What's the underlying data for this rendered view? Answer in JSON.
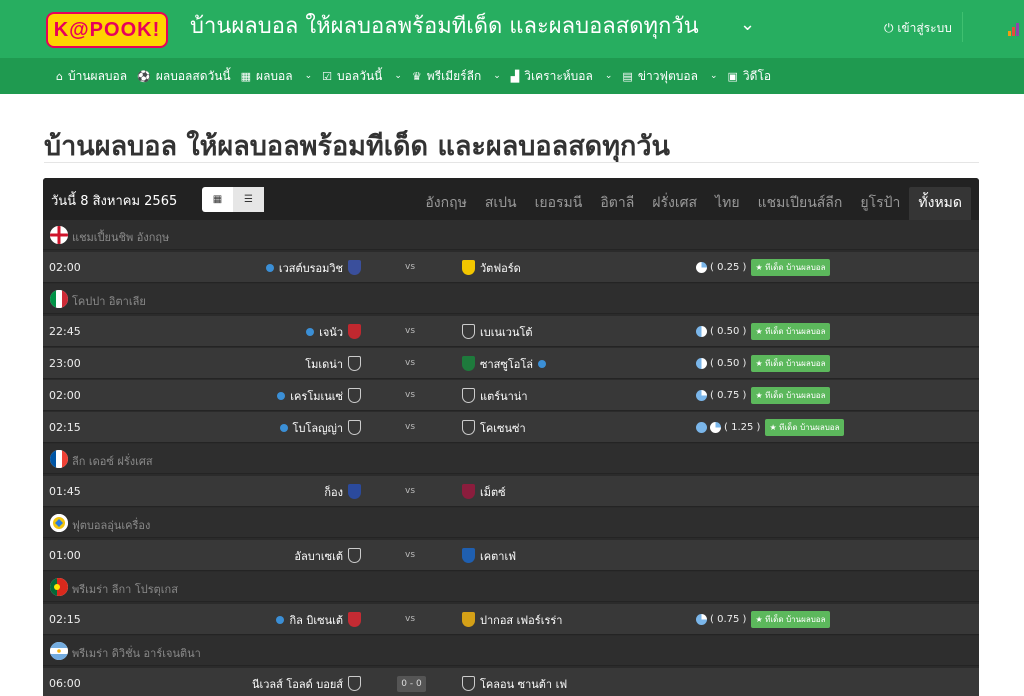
{
  "header": {
    "logo": "K@POOK!",
    "title": "บ้านผลบอล ให้ผลบอลพร้อมทีเด็ด และผลบอลสดทุกวัน",
    "login": "เข้าสู่ระบบ"
  },
  "nav": [
    {
      "label": "บ้านผลบอล",
      "icon": "home-icon",
      "glyph": "⌂",
      "dd": false
    },
    {
      "label": "ผลบอลสดวันนี้",
      "icon": "soccer-ball-icon",
      "glyph": "⚽",
      "dd": false
    },
    {
      "label": "ผลบอล",
      "icon": "table-icon",
      "glyph": "▦",
      "dd": true
    },
    {
      "label": "บอลวันนี้",
      "icon": "calendar-check-icon",
      "glyph": "☑",
      "dd": true
    },
    {
      "label": "พรีเมียร์ลีก",
      "icon": "trophy-icon",
      "glyph": "♛",
      "dd": true
    },
    {
      "label": "วิเคราะห์บอล",
      "icon": "area-chart-icon",
      "glyph": "▟",
      "dd": true
    },
    {
      "label": "ข่าวฟุตบอล",
      "icon": "newspaper-icon",
      "glyph": "▤",
      "dd": true
    },
    {
      "label": "วิดีโอ",
      "icon": "video-file-icon",
      "glyph": "▣",
      "dd": false
    }
  ],
  "page_title": "บ้านผลบอล ให้ผลบอลพร้อมทีเด็ด และผลบอลสดทุกวัน",
  "panel": {
    "date": "วันนี้ 8 สิงหาคม 2565",
    "tabs": [
      "อังกฤษ",
      "สเปน",
      "เยอรมนี",
      "อิตาลี",
      "ฝรั่งเศส",
      "ไทย",
      "แชมเปียนส์ลีก",
      "ยูโรป้า",
      "ทั้งหมด"
    ],
    "active_tab": "ทั้งหมด"
  },
  "tip_label": "ทีเด็ด บ้านผลบอล",
  "vs_label": "vs",
  "leagues": [
    {
      "name": "แชมเปี้ยนชิพ อังกฤษ",
      "flag": "england",
      "matches": [
        {
          "time": "02:00",
          "home": "เวสต์บรอมวิช",
          "home_dot": true,
          "home_crest": "#3a4f9c",
          "away": "วัตฟอร์ด",
          "away_dot": false,
          "away_crest": "#f2c600",
          "odds": "( 0.25 )",
          "balls": [
            "q"
          ],
          "tip": true
        }
      ]
    },
    {
      "name": "โคปปา อิตาเลีย",
      "flag": "italy",
      "matches": [
        {
          "time": "22:45",
          "home": "เจนัว",
          "home_dot": true,
          "home_crest": "#c0282f",
          "away": "เบเนเวนโต้",
          "away_dot": false,
          "away_crest": "",
          "odds": "( 0.50 )",
          "balls": [
            "h"
          ],
          "tip": true
        },
        {
          "time": "23:00",
          "home": "โมเดน่า",
          "home_dot": false,
          "home_crest": "",
          "away": "ซาสซูโอโล่",
          "away_dot": true,
          "away_crest": "#1e7a3c",
          "odds": "( 0.50 )",
          "balls": [
            "h"
          ],
          "tip": true
        },
        {
          "time": "02:00",
          "home": "เครโมเนเซ่",
          "home_dot": true,
          "home_crest": "",
          "away": "แตร์นาน่า",
          "away_dot": false,
          "away_crest": "",
          "odds": "( 0.75 )",
          "balls": [
            "t"
          ],
          "tip": true
        },
        {
          "time": "02:15",
          "home": "โบโลญญ่า",
          "home_dot": true,
          "home_crest": "",
          "away": "โคเซนซ่า",
          "away_dot": false,
          "away_crest": "",
          "odds": "( 1.25 )",
          "balls": [
            "f",
            "q"
          ],
          "tip": true
        }
      ]
    },
    {
      "name": "ลีก เดอซ์ ฝรั่งเศส",
      "flag": "france",
      "matches": [
        {
          "time": "01:45",
          "home": "ก็อง",
          "home_dot": false,
          "home_crest": "#2b4a9c",
          "away": "เม็ตซ์",
          "away_dot": false,
          "away_crest": "#8b1d3d",
          "odds": "",
          "balls": [],
          "tip": false
        }
      ]
    },
    {
      "name": "ฟุตบอลอุ่นเครื่อง",
      "flag": "friendly",
      "matches": [
        {
          "time": "01:00",
          "home": "อัลบาเซเต้",
          "home_dot": false,
          "home_crest": "",
          "away": "เคตาเฟ่",
          "away_dot": false,
          "away_crest": "#1f5fb0",
          "odds": "",
          "balls": [],
          "tip": false
        }
      ]
    },
    {
      "name": "พรีเมร่า ลีกา โปรตุเกส",
      "flag": "portugal",
      "matches": [
        {
          "time": "02:15",
          "home": "กิล บิเซนเต้",
          "home_dot": true,
          "home_crest": "#c42b33",
          "away": "ปากอส เฟอร์เรร่า",
          "away_dot": false,
          "away_crest": "#d4a017",
          "odds": "( 0.75 )",
          "balls": [
            "t"
          ],
          "tip": true
        }
      ]
    },
    {
      "name": "พรีเมร่า ดิวิชั่น อาร์เจนตินา",
      "flag": "argentina",
      "matches": [
        {
          "time": "06:00",
          "home": "นีเวลส์ โอลด์ บอยส์",
          "home_dot": false,
          "home_crest": "",
          "score": "0 - 0",
          "away": "โคลอน ซานต้า เฟ",
          "away_dot": false,
          "away_crest": "",
          "odds": "",
          "balls": [],
          "tip": false
        }
      ]
    }
  ],
  "colors": {
    "brand_green": "#27ae60",
    "nav_green": "#1f9a50",
    "tip_green": "#5cb85c",
    "dot_blue": "#3b8fd6"
  }
}
